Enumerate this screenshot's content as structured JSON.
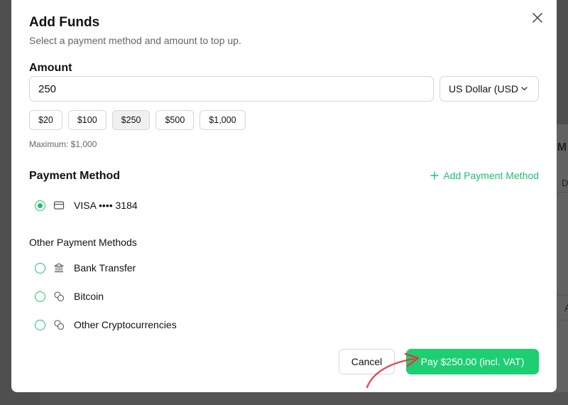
{
  "background": {
    "peek_texts": [
      "t M",
      "D",
      "A"
    ]
  },
  "modal": {
    "title": "Add Funds",
    "subtitle": "Select a payment method and amount to top up.",
    "amount": {
      "label": "Amount",
      "value": "250",
      "currency": "US Dollar (USD",
      "presets": [
        "$20",
        "$100",
        "$250",
        "$500",
        "$1,000"
      ],
      "selected_preset": "$250",
      "max_note": "Maximum: $1,000"
    },
    "payment_method": {
      "label": "Payment Method",
      "add_label": "Add Payment Method",
      "saved": [
        {
          "label": "VISA •••• 3184",
          "icon": "credit-card-icon",
          "selected": true
        }
      ]
    },
    "other_methods": {
      "label": "Other Payment Methods",
      "items": [
        {
          "label": "Bank Transfer",
          "icon": "bank-icon",
          "selected": false
        },
        {
          "label": "Bitcoin",
          "icon": "coins-icon",
          "selected": false
        },
        {
          "label": "Other Cryptocurrencies",
          "icon": "coins-icon",
          "selected": false
        }
      ]
    },
    "footer": {
      "cancel_label": "Cancel",
      "pay_label": "Pay $250.00 (incl. VAT)"
    }
  },
  "colors": {
    "accent": "#1ece73",
    "accent_text": "#1fbf6e",
    "annotation_arrow": "#e0393e"
  }
}
